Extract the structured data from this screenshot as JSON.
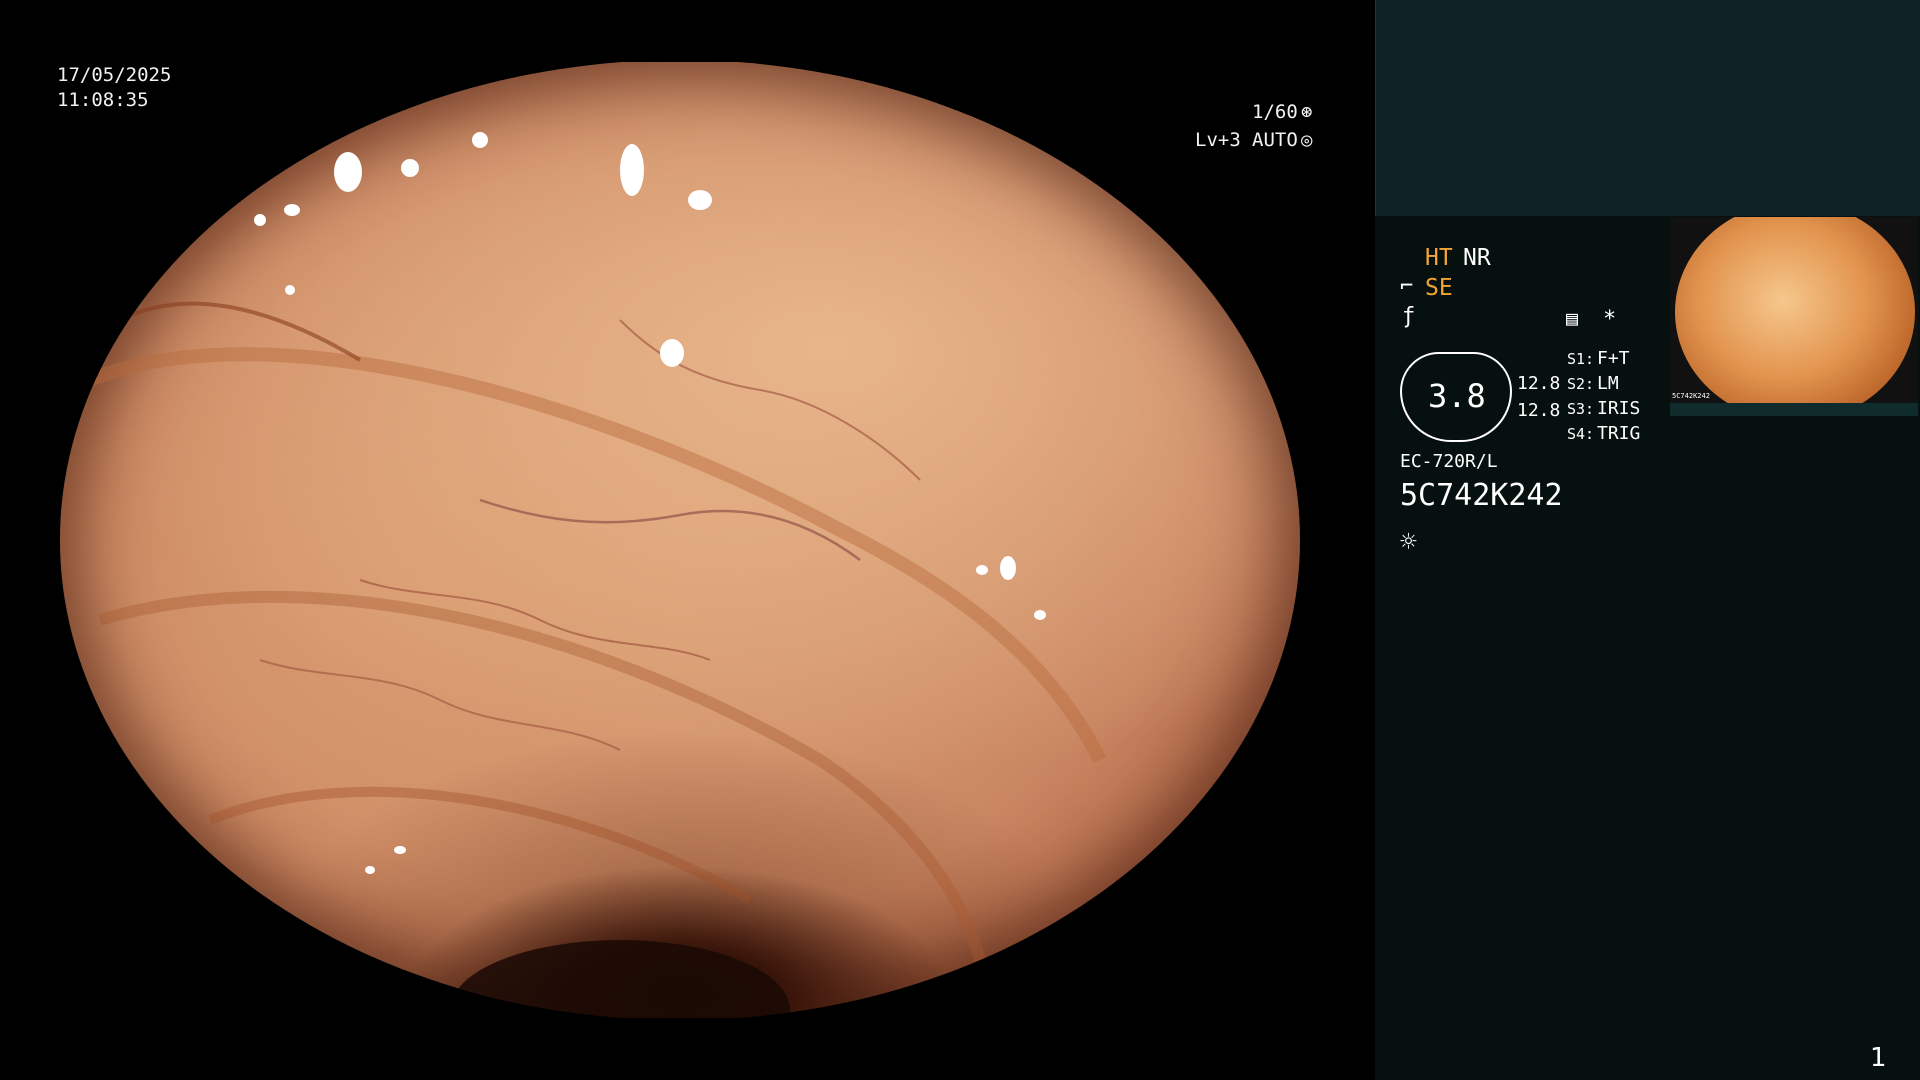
{
  "osd_left": {
    "date": "17/05/2025",
    "time": "11:08:35"
  },
  "osd_right": {
    "shutter": "1/60",
    "level": "Lv+3",
    "exposure_mode": "AUTO"
  },
  "status_panel": {
    "ht_label": "HT",
    "nr_label": "NR",
    "se_label": "SE",
    "iris_value": "3.8",
    "value_1": "12.8",
    "value_2": "12.8",
    "switches": [
      {
        "key": "S1:",
        "value": "F+T"
      },
      {
        "key": "S2:",
        "value": "LM"
      },
      {
        "key": "S3:",
        "value": "IRIS"
      },
      {
        "key": "S4:",
        "value": "TRIG"
      }
    ],
    "scope_model": "EC-720R/L",
    "serial": "5C742K242",
    "asterisk": "*"
  },
  "thumbnail": {
    "tiny_serial": "5C742K242"
  },
  "page_number": "1",
  "colors": {
    "accent_orange": "#f3a533",
    "panel_dark": "#06100f",
    "panel_top": "#0e2424"
  },
  "icons": [
    "aperture-icon",
    "auto-exposure-icon",
    "scope-angle-icon",
    "freeze-icon",
    "document-icon",
    "light-icon"
  ]
}
